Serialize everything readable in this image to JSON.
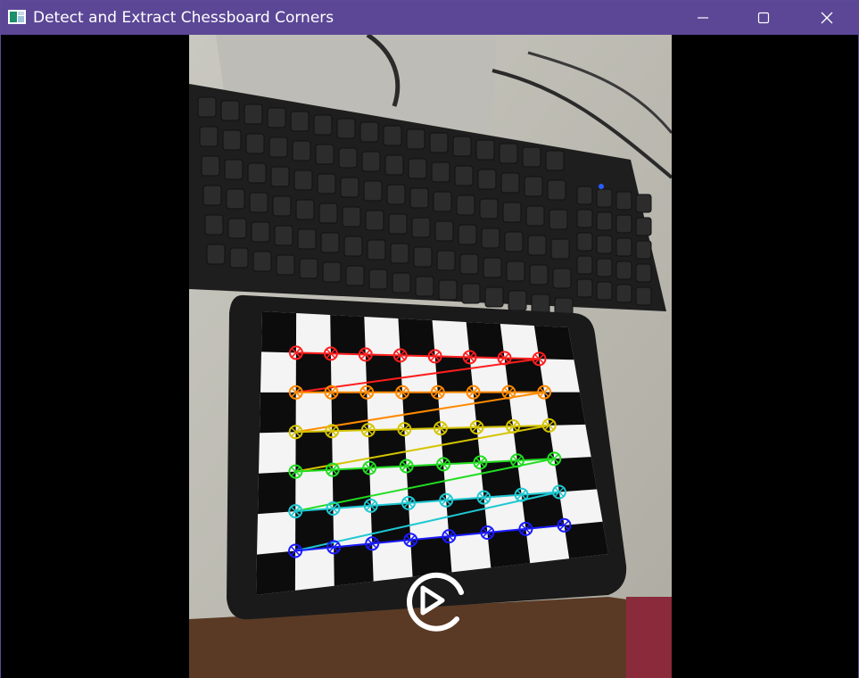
{
  "window": {
    "title": "Detect and Extract Chessboard Corners",
    "controls": [
      {
        "name": "minimize-button",
        "icon": "minimize-icon"
      },
      {
        "name": "maximize-button",
        "icon": "maximize-icon"
      },
      {
        "name": "close-button",
        "icon": "close-icon"
      }
    ],
    "titlebar_color": "#5b4796",
    "app_icon": "opencv-window-icon"
  },
  "frame": {
    "content": "camera-frame-with-chessboard-on-tablet",
    "overlay_icon": "play-logo-icon",
    "detected_corners": {
      "rows": 6,
      "cols": 8,
      "row_colors": [
        "#ff1e1e",
        "#ff8a00",
        "#d4c400",
        "#22dd22",
        "#1ec8d2",
        "#1a1aff"
      ]
    }
  }
}
